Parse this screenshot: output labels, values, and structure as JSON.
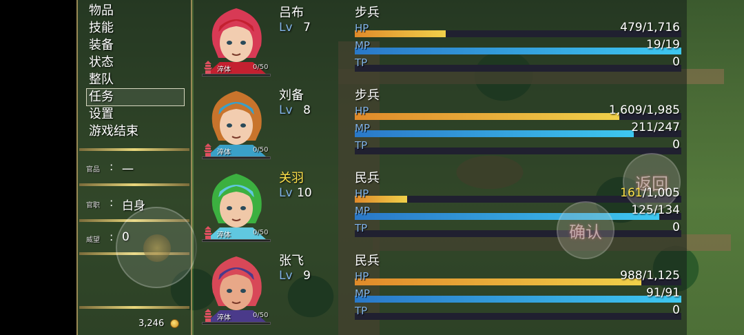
{
  "menu": {
    "items": [
      {
        "label": "物品"
      },
      {
        "label": "技能"
      },
      {
        "label": "装备"
      },
      {
        "label": "状态"
      },
      {
        "label": "整队"
      },
      {
        "label": "任务"
      },
      {
        "label": "设置"
      },
      {
        "label": "游戏结束"
      }
    ],
    "selected_index": 5
  },
  "status": {
    "rank": {
      "label": "官品",
      "value": "一"
    },
    "post": {
      "label": "官职",
      "value": "白身"
    },
    "prestige": {
      "label": "威望",
      "value": "0"
    }
  },
  "gold": {
    "value": "3,246",
    "icon": "coin-icon"
  },
  "party": [
    {
      "name": "吕布",
      "highlight": false,
      "lv_label": "Lv",
      "level": "7",
      "class": "步兵",
      "rank_label": "淬体",
      "exp": "0/50",
      "exp_ratio": 0,
      "hair": "#d83a55",
      "skin": "#f2cdb0",
      "accent": "#c42030",
      "hp": {
        "label": "HP",
        "cur": "479",
        "max": "1,716",
        "sep": "/",
        "ratio": 0.279,
        "low": false
      },
      "mp": {
        "label": "MP",
        "cur": "19",
        "max": "19",
        "sep": "/",
        "ratio": 1.0
      },
      "tp": {
        "label": "TP",
        "value": "0",
        "ratio": 0
      }
    },
    {
      "name": "刘备",
      "highlight": false,
      "lv_label": "Lv",
      "level": "8",
      "class": "步兵",
      "rank_label": "淬体",
      "exp": "0/50",
      "exp_ratio": 0,
      "hair": "#c8742c",
      "skin": "#f2cdb0",
      "accent": "#3aa0c8",
      "hp": {
        "label": "HP",
        "cur": "1,609",
        "max": "1,985",
        "sep": "/",
        "ratio": 0.811,
        "low": false
      },
      "mp": {
        "label": "MP",
        "cur": "211",
        "max": "247",
        "sep": "/",
        "ratio": 0.854
      },
      "tp": {
        "label": "TP",
        "value": "0",
        "ratio": 0
      }
    },
    {
      "name": "关羽",
      "highlight": true,
      "lv_label": "Lv",
      "level": "10",
      "class": "民兵",
      "rank_label": "淬体",
      "exp": "0/50",
      "exp_ratio": 0,
      "hair": "#3cb040",
      "skin": "#f0c8a8",
      "accent": "#60c8e0",
      "hp": {
        "label": "HP",
        "cur": "161",
        "max": "1,005",
        "sep": "/",
        "ratio": 0.16,
        "low": true
      },
      "mp": {
        "label": "MP",
        "cur": "125",
        "max": "134",
        "sep": "/",
        "ratio": 0.933
      },
      "tp": {
        "label": "TP",
        "value": "0",
        "ratio": 0
      }
    },
    {
      "name": "张飞",
      "highlight": false,
      "lv_label": "Lv",
      "level": "9",
      "class": "民兵",
      "rank_label": "淬体",
      "exp": "0/50",
      "exp_ratio": 0,
      "hair": "#d84858",
      "skin": "#e8a888",
      "accent": "#4a3a8a",
      "hp": {
        "label": "HP",
        "cur": "988",
        "max": "1,125",
        "sep": "/",
        "ratio": 0.878,
        "low": false
      },
      "mp": {
        "label": "MP",
        "cur": "91",
        "max": "91",
        "sep": "/",
        "ratio": 1.0
      },
      "tp": {
        "label": "TP",
        "value": "0",
        "ratio": 0
      }
    }
  ],
  "buttons": {
    "back": {
      "label": "返回"
    },
    "ok": {
      "label": "确认"
    }
  },
  "colors": {
    "gold_border": "#e9d77c",
    "hp_fill": "#f0d04a",
    "mp_fill": "#3ec8f0",
    "highlight_name": "#ffe14a",
    "system_label": "#82b4e8"
  }
}
